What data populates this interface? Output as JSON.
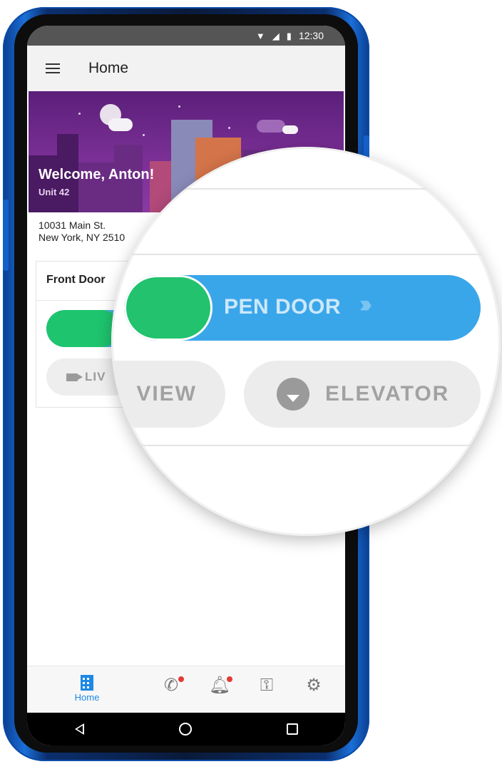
{
  "status_bar": {
    "time": "12:30"
  },
  "app_bar": {
    "title": "Home"
  },
  "banner": {
    "welcome": "Welcome, Anton!",
    "unit": "Unit 42"
  },
  "address": {
    "line1": "10031 Main St.",
    "line2": "New York, NY 2510"
  },
  "door_card": {
    "title": "Front Door",
    "open_door_label": "PEN DOOR",
    "live_view_label_small": "LIV",
    "live_view_label_zoom": "VIEW",
    "elevator_label": "ELEVATOR"
  },
  "bottom_nav": {
    "items": [
      {
        "label": "Home",
        "icon": "building-icon",
        "active": true
      },
      {
        "label": "",
        "icon": "phone-icon",
        "notification": true
      },
      {
        "label": "",
        "icon": "bell-icon",
        "notification": true
      },
      {
        "label": "",
        "icon": "key-icon"
      },
      {
        "label": "",
        "icon": "user-settings-icon"
      }
    ]
  },
  "colors": {
    "accent_blue": "#1e88e5",
    "slider_green": "#22c26e",
    "slider_blue": "#3aa6ea",
    "banner_purple": "#7a2f95",
    "notification_red": "#e53935"
  }
}
